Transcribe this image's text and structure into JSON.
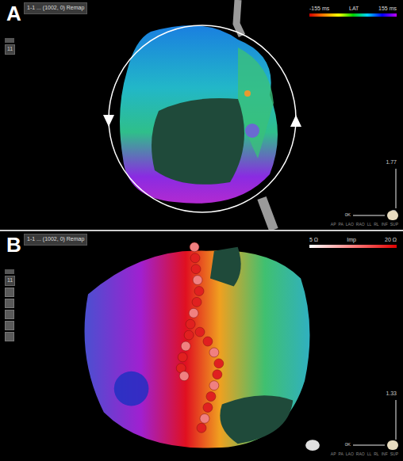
{
  "panels": [
    {
      "label": "A",
      "header": "1-1 ... (1002, 0) Remap",
      "toolbar": "11",
      "legends": [
        {
          "title": "LAT",
          "min": "-155 ms",
          "max": "155 ms",
          "kind": "rainbow"
        }
      ],
      "zoom": "1.77",
      "slider": "0K",
      "views": [
        "AP",
        "PA",
        "LAO",
        "RAO",
        "LL",
        "RL",
        "INF",
        "SUP"
      ]
    },
    {
      "label": "B",
      "header": "1-1 ... (1002, 0) Remap",
      "toolbar": "11",
      "legends": [
        {
          "title": "Imp",
          "min": "5 Ω",
          "max": "20 Ω",
          "kind": "impedance"
        }
      ],
      "zoom": "1.33",
      "slider": "0K",
      "views": [
        "AP",
        "PA",
        "LAO",
        "RAO",
        "LL",
        "RL",
        "INF",
        "SUP"
      ]
    }
  ]
}
